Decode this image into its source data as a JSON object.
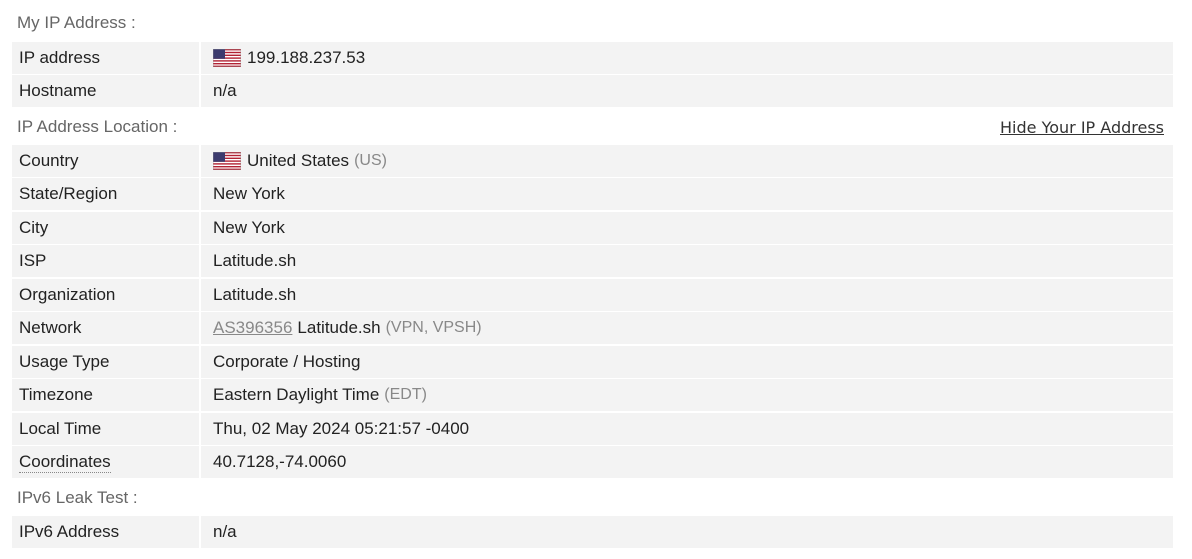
{
  "sections": {
    "my_ip": "My IP Address :",
    "location": "IP Address Location :",
    "ipv6": "IPv6 Leak Test :"
  },
  "hide_link": "Hide Your IP Address",
  "rows": {
    "ip": {
      "label": "IP address",
      "value": "199.188.237.53",
      "icon": "us-flag-icon"
    },
    "hostname": {
      "label": "Hostname",
      "value": "n/a"
    },
    "country": {
      "label": "Country",
      "value": "United States",
      "code": "(US)",
      "icon": "us-flag-icon"
    },
    "state": {
      "label": "State/Region",
      "value": "New York"
    },
    "city": {
      "label": "City",
      "value": "New York"
    },
    "isp": {
      "label": "ISP",
      "value": "Latitude.sh"
    },
    "org": {
      "label": "Organization",
      "value": "Latitude.sh"
    },
    "network": {
      "label": "Network",
      "asn": "AS396356",
      "value": "Latitude.sh",
      "note": "(VPN, VPSH)"
    },
    "usage": {
      "label": "Usage Type",
      "value": "Corporate / Hosting"
    },
    "timezone": {
      "label": "Timezone",
      "value": "Eastern Daylight Time",
      "note": "(EDT)"
    },
    "local_time": {
      "label": "Local Time",
      "value": "Thu, 02 May 2024 05:21:57 -0400"
    },
    "coordinates": {
      "label": "Coordinates",
      "value": "40.7128,-74.0060"
    },
    "ipv6": {
      "label": "IPv6 Address",
      "value": "n/a"
    }
  },
  "colors": {
    "row_bg": "#f3f3f3",
    "section_text": "#666666",
    "muted_text": "#888888"
  }
}
